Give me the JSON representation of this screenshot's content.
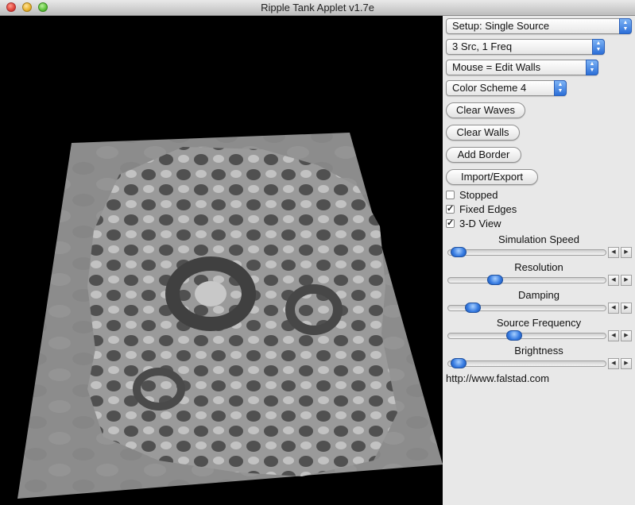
{
  "window": {
    "title": "Ripple Tank Applet v1.7e"
  },
  "selects": [
    {
      "label": "Setup: Single Source"
    },
    {
      "label": "3 Src, 1 Freq"
    },
    {
      "label": "Mouse = Edit Walls"
    },
    {
      "label": "Color Scheme 4"
    }
  ],
  "buttons": {
    "clear_waves": "Clear Waves",
    "clear_walls": "Clear Walls",
    "add_border": "Add Border",
    "import_export": "Import/Export"
  },
  "checkboxes": [
    {
      "label": "Stopped",
      "checked": false
    },
    {
      "label": "Fixed Edges",
      "checked": true
    },
    {
      "label": "3-D View",
      "checked": true
    }
  ],
  "sliders": [
    {
      "label": "Simulation Speed",
      "value": 0.02
    },
    {
      "label": "Resolution",
      "value": 0.28
    },
    {
      "label": "Damping",
      "value": 0.12
    },
    {
      "label": "Source Frequency",
      "value": 0.41
    },
    {
      "label": "Brightness",
      "value": 0.02
    }
  ],
  "footer": {
    "url": "http://www.falstad.com"
  },
  "colors": {
    "surface": "#8f8f8f",
    "wave_dark": "#4d4d4d",
    "wave_light": "#c4c4c4",
    "accent": "#2c6fd8"
  }
}
